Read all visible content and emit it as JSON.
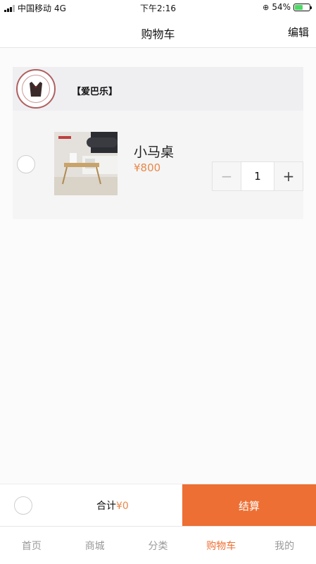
{
  "status_bar": {
    "carrier": "中国移动",
    "network": "4G",
    "time": "下午2:16",
    "battery_percent": "54%"
  },
  "nav": {
    "title": "购物车",
    "edit_label": "编辑"
  },
  "shop": {
    "name": "【爱巴乐】",
    "item": {
      "name": "小马桌",
      "price": "¥800",
      "quantity": "1",
      "minus_label": "−",
      "plus_label": "+"
    }
  },
  "checkout": {
    "total_label": "合计",
    "total_amount": "¥0",
    "checkout_label": "结算"
  },
  "tabs": [
    {
      "label": "首页",
      "active": false
    },
    {
      "label": "商城",
      "active": false
    },
    {
      "label": "分类",
      "active": false
    },
    {
      "label": "购物车",
      "active": true
    },
    {
      "label": "我的",
      "active": false
    }
  ],
  "colors": {
    "accent": "#ed6f33",
    "price": "#e8884a"
  }
}
